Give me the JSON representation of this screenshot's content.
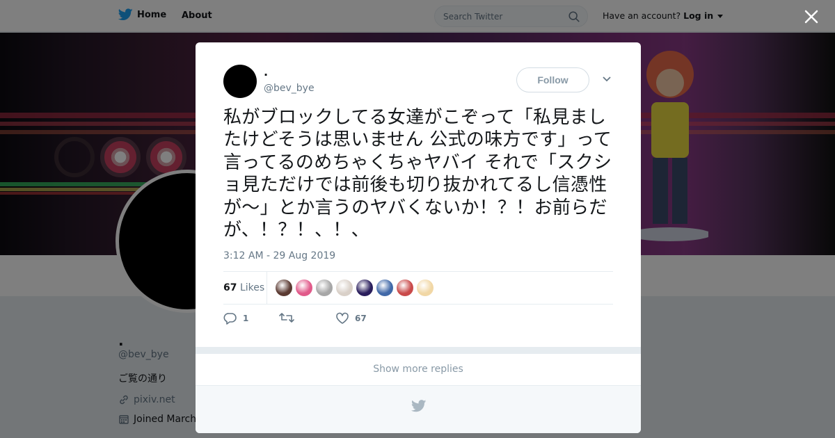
{
  "nav": {
    "home_label": "Home",
    "about_label": "About",
    "search_placeholder": "Search Twitter",
    "account_prompt": "Have an account?",
    "login_label": "Log in",
    "icons": {
      "logo": "twitter-bird-icon",
      "search": "search-icon",
      "caret": "caret-down-icon"
    }
  },
  "profile": {
    "display_name": ".",
    "handle": "@bev_bye",
    "bio": "ご覧の通り",
    "link": "pixiv.net",
    "joined": "Joined March"
  },
  "tweet": {
    "display_name": ".",
    "handle": "@bev_bye",
    "follow_label": "Follow",
    "text": "私がブロックしてる女達がこぞって「私見ましたけどそうは思いません 公式の味方です」って言ってるのめちゃくちゃヤバイ それで「スクショ見ただけでは前後も切り抜かれてるし信憑性が〜」とか言うのヤバくないか！？！お前らだが、！？！、！、",
    "timestamp": "3:12 AM - 29 Aug 2019",
    "likes_count": "67",
    "likes_label": "Likes",
    "liker_colors": [
      "#5b3a32",
      "#e15a8a",
      "#a7a7a7",
      "#d9d0c8",
      "#2a1e5c",
      "#4169a8",
      "#c94a4a",
      "#f1d7a5"
    ],
    "reply_count": "1",
    "retweet_count": "",
    "like_count": "67",
    "show_more_label": "Show more replies",
    "icons": {
      "reply": "reply-icon",
      "retweet": "retweet-icon",
      "like": "heart-icon",
      "more": "chevron-down-icon",
      "close": "close-icon"
    }
  },
  "colors": {
    "brand": "#1da1f2",
    "text": "#14171a",
    "muted": "#657786"
  }
}
